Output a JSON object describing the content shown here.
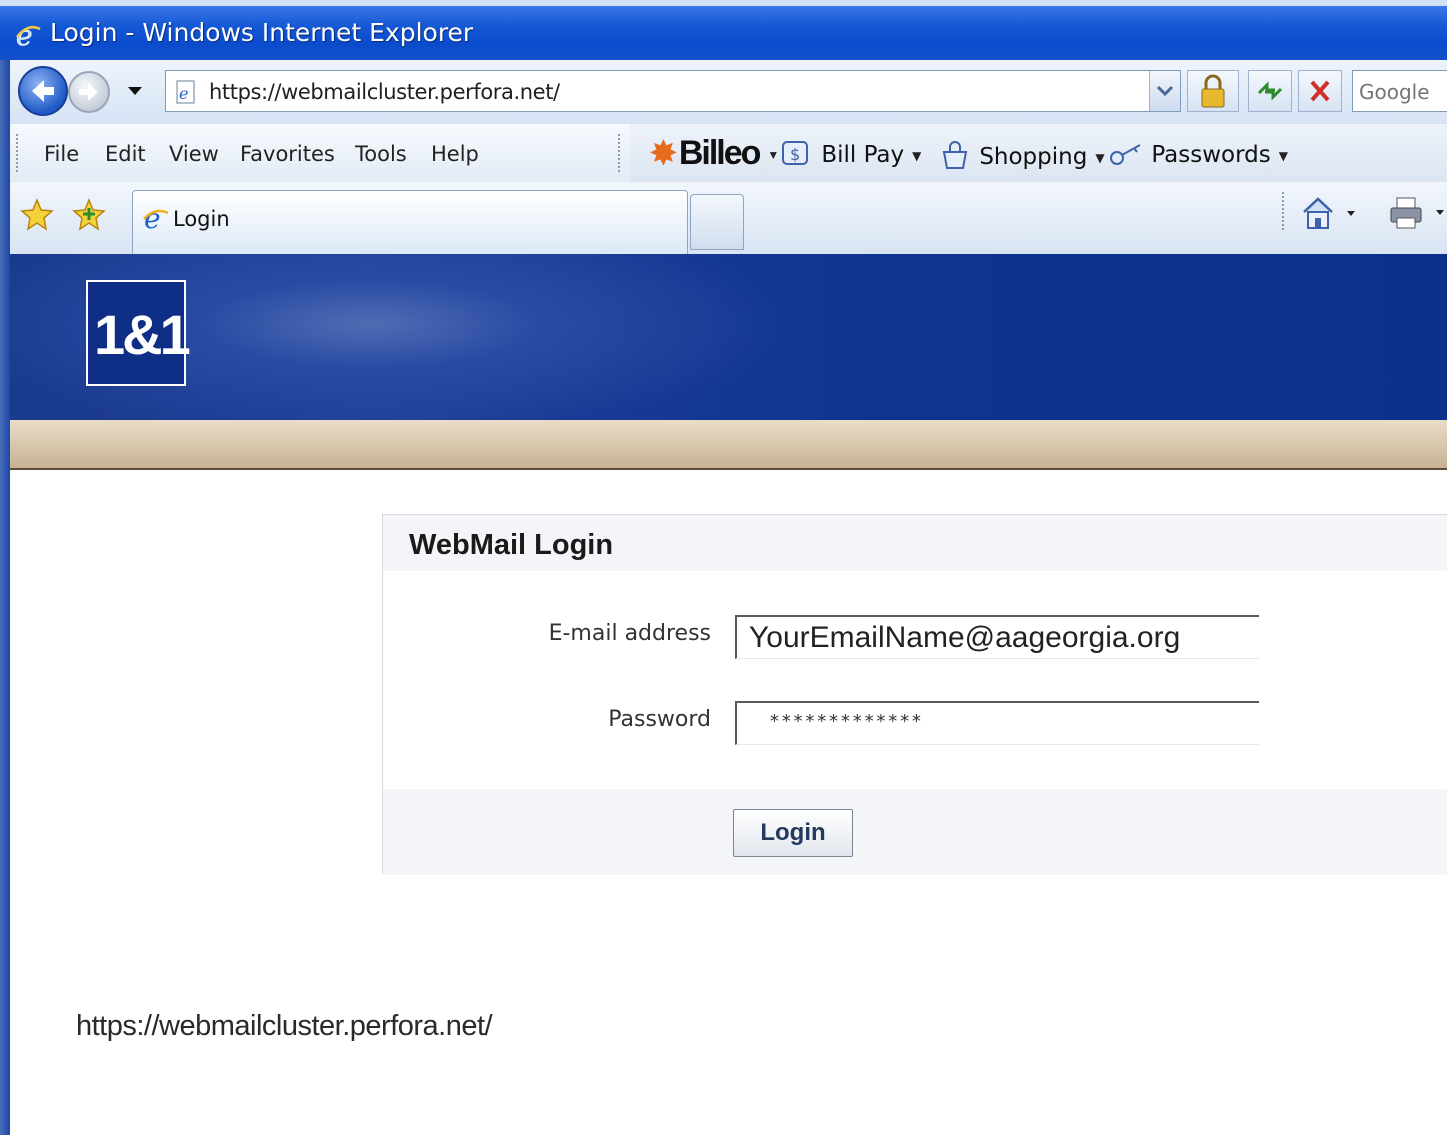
{
  "window": {
    "title": "Login - Windows Internet Explorer"
  },
  "address_bar": {
    "url": "https://webmailcluster.perfora.net/",
    "search_placeholder": "Google"
  },
  "menu": {
    "items": [
      "File",
      "Edit",
      "View",
      "Favorites",
      "Tools",
      "Help"
    ]
  },
  "toolbar": {
    "brand": "Billeo",
    "items": [
      "Bill Pay",
      "Shopping",
      "Passwords"
    ]
  },
  "tabs": [
    {
      "label": "Login"
    }
  ],
  "page": {
    "logo_text": "1&1",
    "login_box": {
      "heading": "WebMail Login",
      "email_label": "E-mail address",
      "email_value": "YourEmailName@aageorgia.org",
      "password_label": "Password",
      "password_value": "*************",
      "login_button": "Login"
    },
    "url_caption": "https://webmailcluster.perfora.net/"
  },
  "colors": {
    "banner": "#0f3490",
    "tan_bar": "#c6b293",
    "title_bar": "#0a4ccc"
  }
}
